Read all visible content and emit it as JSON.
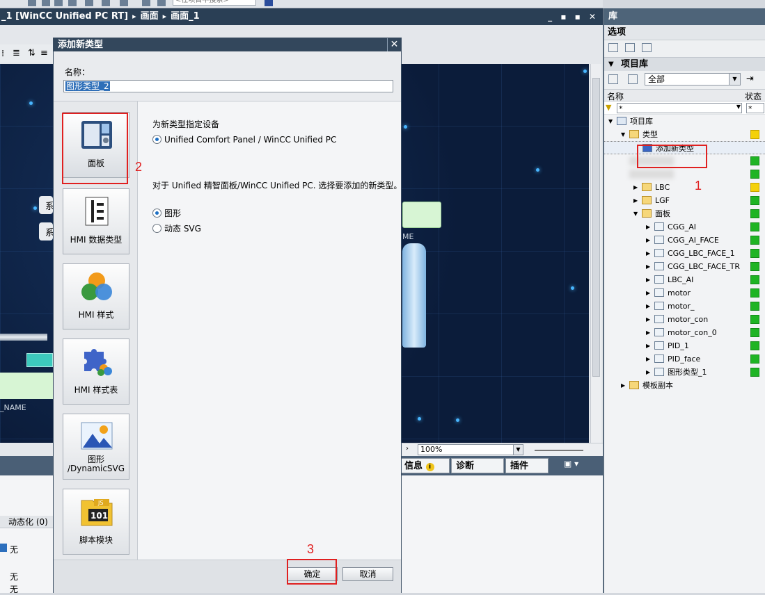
{
  "topbar": {
    "search_placeholder": "<在项目中搜索>"
  },
  "editor": {
    "breadcrumb": [
      "_1 [WinCC Unified PC RT]",
      "画面",
      "画面_1"
    ],
    "window_buttons": "_ ▪ ▪ ✕",
    "zoom": "100%",
    "canvas_fragments": {
      "btn1": "系",
      "btn2": "系",
      "name1": "ME",
      "name2": "_NAME"
    }
  },
  "inspector": {
    "tabs": [
      "信息",
      "诊断",
      "插件"
    ],
    "column_header": "动态化 (0)",
    "rows": [
      "无",
      "无",
      "无"
    ]
  },
  "library": {
    "title": "库",
    "options_label": "选项",
    "project_library_label": "项目库",
    "filter_value": "全部",
    "col_name": "名称",
    "col_status": "状态",
    "filter_name": "*",
    "filter_status": "*",
    "tree": {
      "root": "项目库",
      "types": "类型",
      "add_new_type": "添加新类型",
      "lbc": "LBC",
      "lgf": "LGF",
      "panel": "面板",
      "panel_items": [
        "CGG_AI",
        "CGG_AI_FACE",
        "CGG_LBC_FACE_1",
        "CGG_LBC_FACE_TR",
        "LBC_AI",
        "motor",
        "motor_",
        "motor_con",
        "motor_con_0",
        "PID_1",
        "PID_face",
        "图形类型_1"
      ],
      "master_copies": "模板副本"
    }
  },
  "dialog": {
    "title": "添加新类型",
    "name_label": "名称：",
    "name_value": "图形类型_2",
    "types": [
      {
        "label": "面板",
        "icon": "panel-icon"
      },
      {
        "label": "HMI 数据类型",
        "icon": "data-type-icon"
      },
      {
        "label": "HMI 样式",
        "icon": "style-icon"
      },
      {
        "label": "HMI 样式表",
        "icon": "stylesheet-icon"
      },
      {
        "label_line1": "图形",
        "label_line2": "/DynamicSVG",
        "icon": "graphic-icon"
      },
      {
        "label": "脚本模块",
        "icon": "script-module-icon"
      }
    ],
    "device_heading": "为新类型指定设备",
    "device_option": "Unified Comfort Panel / WinCC Unified PC",
    "type_prompt": "对于 Unified 精智面板/WinCC Unified PC. 选择要添加的新类型。",
    "option_graphic": "图形",
    "option_svg": "动态 SVG",
    "ok_label": "确定",
    "cancel_label": "取消"
  },
  "annotations": [
    "1",
    "2",
    "3"
  ],
  "colors": {
    "accent_red": "#e02020",
    "status_green": "#1fb424",
    "status_yellow": "#f4d10a",
    "titlebar": "#2a3f55"
  }
}
